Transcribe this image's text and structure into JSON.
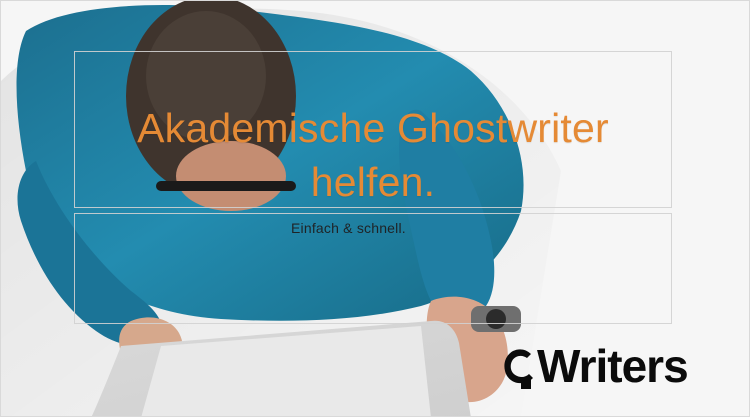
{
  "hero": {
    "headline": "Akademische Ghostwriter helfen.",
    "subline": "Einfach & schnell."
  },
  "logo": {
    "text": "Writers",
    "mark_icon": "c-logo-mark-icon"
  },
  "colors": {
    "headline": "#e58a35",
    "shirt": "#1f7fa0",
    "desk": "#f2f2f2"
  }
}
